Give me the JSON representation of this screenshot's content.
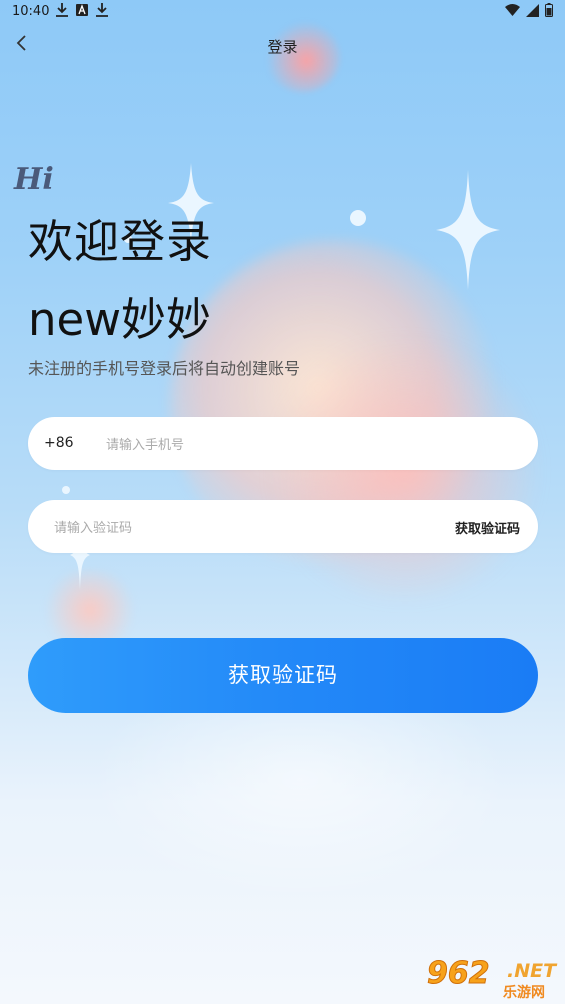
{
  "status_bar": {
    "time": "10:40"
  },
  "nav": {
    "title": "登录"
  },
  "greeting": {
    "hi": "Hi",
    "line1": "欢迎登录",
    "line2": "new妙妙",
    "subtitle": "未注册的手机号登录后将自动创建账号"
  },
  "phone_field": {
    "country_code": "+86",
    "placeholder": "请输入手机号",
    "value": ""
  },
  "code_field": {
    "placeholder": "请输入验证码",
    "value": "",
    "get_code_label": "获取验证码"
  },
  "submit": {
    "label": "获取验证码"
  },
  "watermark": {
    "number": "962",
    "domain": ".NET",
    "name": "乐游网"
  },
  "colors": {
    "accent": "#2389f8",
    "watermark": "#f7a21b"
  },
  "icons": [
    "download-icon",
    "a-icon",
    "download-icon",
    "wifi-icon",
    "signal-icon",
    "battery-icon",
    "back-arrow-icon"
  ]
}
